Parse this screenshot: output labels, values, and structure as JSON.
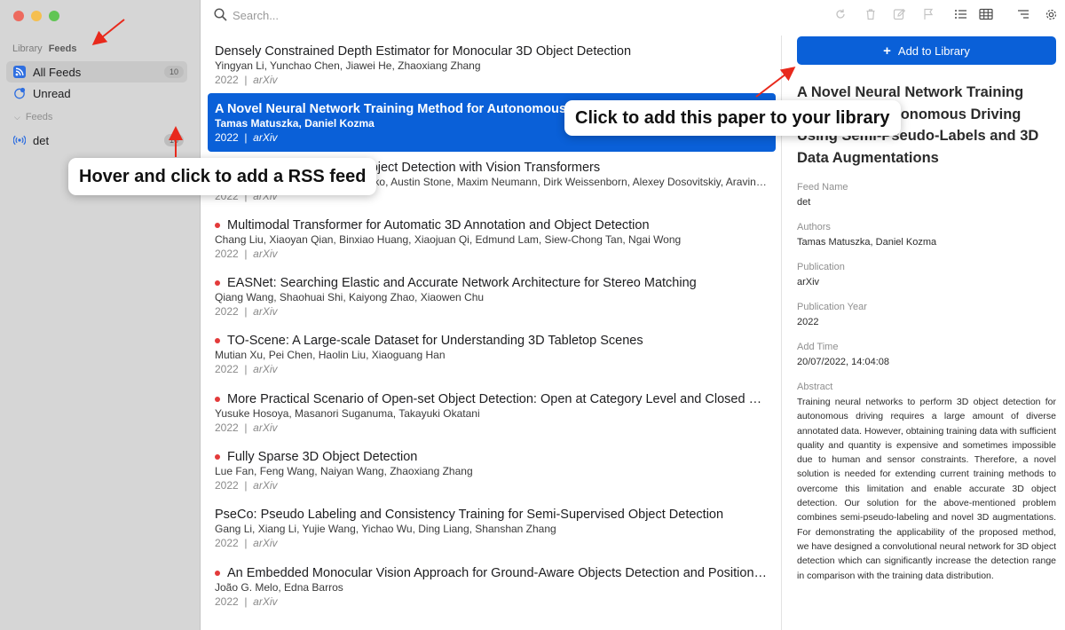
{
  "window": {
    "controls": [
      "close",
      "minimize",
      "zoom"
    ]
  },
  "sidebar": {
    "tabs": [
      {
        "label": "Library",
        "active": false
      },
      {
        "label": "Feeds",
        "active": true
      }
    ],
    "items": [
      {
        "label": "All Feeds",
        "count": "10",
        "icon": "rss-icon",
        "selected": true
      },
      {
        "label": "Unread",
        "icon": "unread-dot-icon",
        "selected": false
      }
    ],
    "section": {
      "label": "Feeds"
    },
    "feeds": [
      {
        "label": "det",
        "count": "10",
        "icon": "broadcast-icon"
      }
    ]
  },
  "toolbar": {
    "search_placeholder": "Search...",
    "buttons": [
      "refresh-icon",
      "trash-icon",
      "edit-icon",
      "flag-icon",
      "list-view-icon",
      "table-view-icon",
      "sort-icon",
      "settings-icon"
    ]
  },
  "papers": [
    {
      "title": "Densely Constrained Depth Estimator for Monocular 3D Object Detection",
      "authors": "Yingyan Li, Yunchao Chen, Jiawei He, Zhaoxiang Zhang",
      "year": "2022",
      "venue": "arXiv",
      "unread": false,
      "selected": false
    },
    {
      "title": "A Novel Neural Network Training Method for Autonomous Driving Using Semi-Pseudo-Labels and 3D Data Augmentations",
      "authors": "Tamas Matuszka, Daniel Kozma",
      "year": "2022",
      "venue": "arXiv",
      "unread": false,
      "selected": true
    },
    {
      "title": "Simple Open-Vocabulary Object Detection with Vision Transformers",
      "authors": "Matthias Minderer, Alexey Gritsenko, Austin Stone, Maxim Neumann, Dirk Weissenborn, Alexey Dosovitskiy, Aravindh Mahendran",
      "year": "2022",
      "venue": "arXiv",
      "unread": false,
      "selected": false
    },
    {
      "title": "Multimodal Transformer for Automatic 3D Annotation and Object Detection",
      "authors": "Chang Liu, Xiaoyan Qian, Binxiao Huang, Xiaojuan Qi, Edmund Lam, Siew-Chong Tan, Ngai Wong",
      "year": "2022",
      "venue": "arXiv",
      "unread": true,
      "selected": false
    },
    {
      "title": "EASNet: Searching Elastic and Accurate Network Architecture for Stereo Matching",
      "authors": "Qiang Wang, Shaohuai Shi, Kaiyong Zhao, Xiaowen Chu",
      "year": "2022",
      "venue": "arXiv",
      "unread": true,
      "selected": false
    },
    {
      "title": "TO-Scene: A Large-scale Dataset for Understanding 3D Tabletop Scenes",
      "authors": "Mutian Xu, Pei Chen, Haolin Liu, Xiaoguang Han",
      "year": "2022",
      "venue": "arXiv",
      "unread": true,
      "selected": false
    },
    {
      "title": "More Practical Scenario of Open-set Object Detection: Open at Category Level and Closed at Super-category Level",
      "authors": "Yusuke Hosoya, Masanori Suganuma, Takayuki Okatani",
      "year": "2022",
      "venue": "arXiv",
      "unread": true,
      "selected": false
    },
    {
      "title": "Fully Sparse 3D Object Detection",
      "authors": "Lue Fan, Feng Wang, Naiyan Wang, Zhaoxiang Zhang",
      "year": "2022",
      "venue": "arXiv",
      "unread": true,
      "selected": false
    },
    {
      "title": "PseCo: Pseudo Labeling and Consistency Training for Semi-Supervised Object Detection",
      "authors": "Gang Li, Xiang Li, Yujie Wang, Yichao Wu, Ding Liang, Shanshan Zhang",
      "year": "2022",
      "venue": "arXiv",
      "unread": false,
      "selected": false
    },
    {
      "title": "An Embedded Monocular Vision Approach for Ground-Aware Objects Detection and Position Estimation",
      "authors": "João G. Melo, Edna Barros",
      "year": "2022",
      "venue": "arXiv",
      "unread": true,
      "selected": false
    }
  ],
  "detail": {
    "add_button_label": "Add to Library",
    "title": "A Novel Neural Network Training Method for Autonomous Driving Using Semi-Pseudo-Labels and 3D Data Augmentations",
    "fields": [
      {
        "label": "Feed Name",
        "value": "det"
      },
      {
        "label": "Authors",
        "value": "Tamas Matuszka, Daniel Kozma"
      },
      {
        "label": "Publication",
        "value": "arXiv"
      },
      {
        "label": "Publication Year",
        "value": "2022"
      },
      {
        "label": "Add Time",
        "value": "20/07/2022, 14:04:08"
      }
    ],
    "abstract_label": "Abstract",
    "abstract": "Training neural networks to perform 3D object detection for autonomous driving requires a large amount of diverse annotated data. However, obtaining training data with sufficient quality and quantity is expensive and sometimes impossible due to human and sensor constraints. Therefore, a novel solution is needed for extending current training methods to overcome this limitation and enable accurate 3D object detection. Our solution for the above-mentioned problem combines semi-pseudo-labeling and novel 3D augmentations. For demonstrating the applicability of the proposed method, we have designed a convolutional neural network for 3D object detection which can significantly increase the detection range in comparison with the training data distribution."
  },
  "callouts": {
    "library": "Click to add this paper to your library",
    "rss": "Hover and click to add a RSS feed"
  },
  "colors": {
    "accent": "#0a60d8",
    "unread_dot": "#e33a3a",
    "arrow": "#e8291c",
    "sidebar_bg": "#d6d6d6"
  }
}
